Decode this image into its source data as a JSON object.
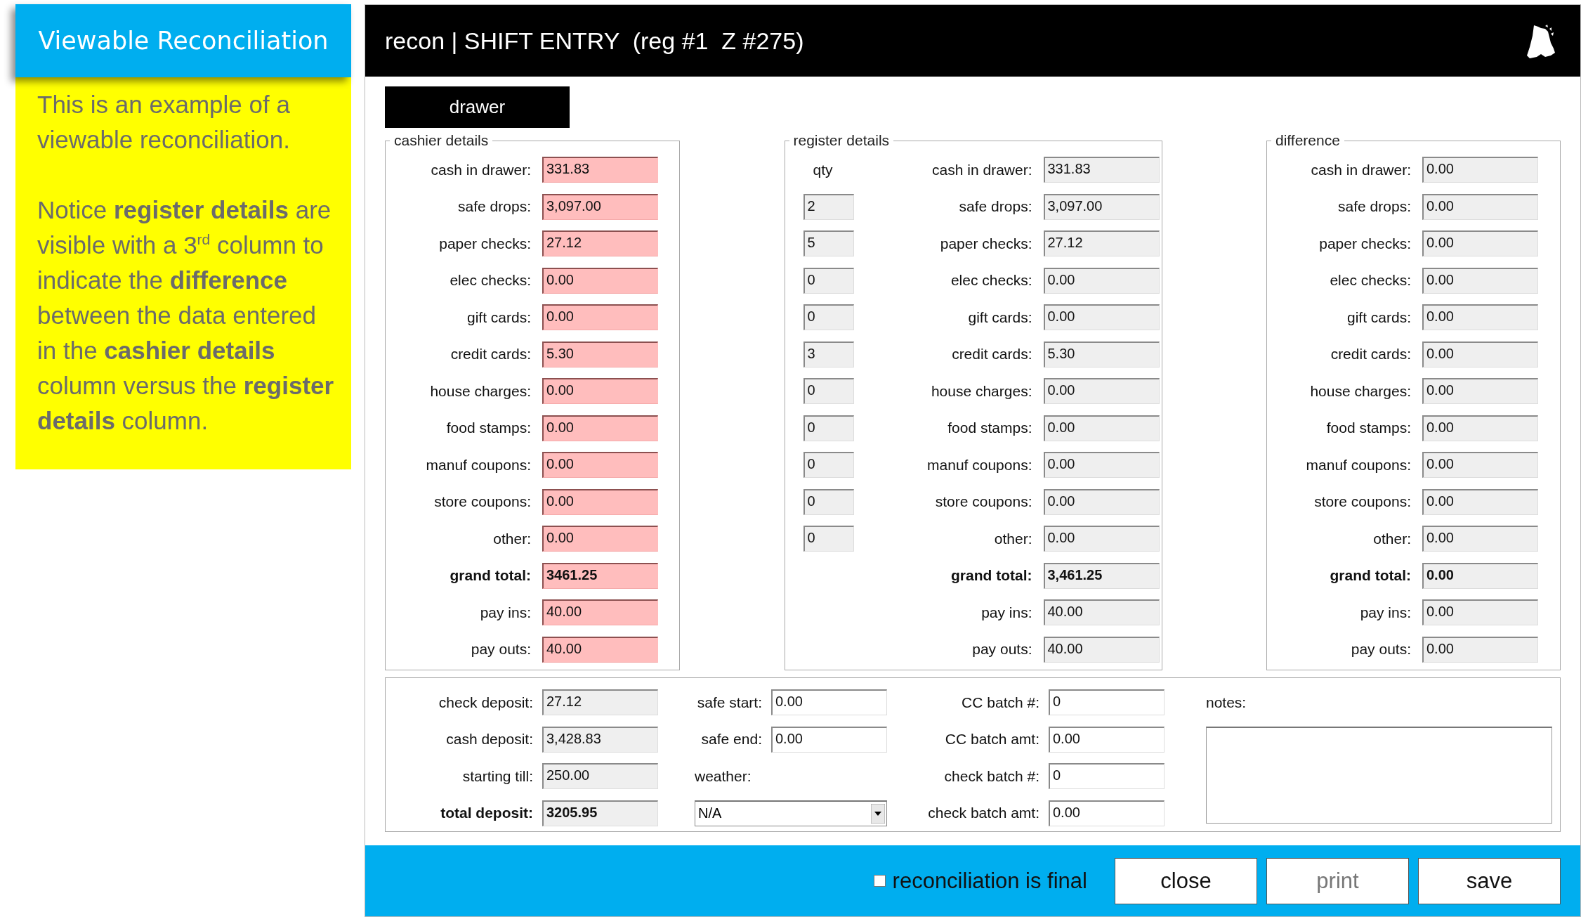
{
  "callout": {
    "title": "Viewable Reconciliation",
    "paragraphs": [
      "This is an example of a viewable reconciliation.",
      "Notice **register details** are visible with a 3$^{rd}$ column to indicate the **difference** between the data entered in the **cashier details** column versus the **register details** column."
    ]
  },
  "window": {
    "title": "recon | SHIFT ENTRY  (reg #1  Z #275)"
  },
  "tabs": [
    {
      "label": "drawer",
      "selected": true
    }
  ],
  "cashier_details": {
    "legend": "cashier details",
    "rows": [
      {
        "label": "cash in drawer:",
        "value": "331.83",
        "kind": "flagged",
        "bold": false
      },
      {
        "label": "safe drops:",
        "value": "3,097.00",
        "kind": "flagged",
        "bold": false
      },
      {
        "label": "paper checks:",
        "value": "27.12",
        "kind": "flagged",
        "bold": false
      },
      {
        "label": "elec checks:",
        "value": "0.00",
        "kind": "flagged",
        "bold": false
      },
      {
        "label": "gift cards:",
        "value": "0.00",
        "kind": "flagged",
        "bold": false
      },
      {
        "label": "credit cards:",
        "value": "5.30",
        "kind": "flagged",
        "bold": false
      },
      {
        "label": "house charges:",
        "value": "0.00",
        "kind": "flagged",
        "bold": false
      },
      {
        "label": "food stamps:",
        "value": "0.00",
        "kind": "flagged",
        "bold": false
      },
      {
        "label": "manuf coupons:",
        "value": "0.00",
        "kind": "flagged",
        "bold": false
      },
      {
        "label": "store coupons:",
        "value": "0.00",
        "kind": "flagged",
        "bold": false
      },
      {
        "label": "other:",
        "value": "0.00",
        "kind": "flagged",
        "bold": false
      },
      {
        "label": "grand total:",
        "value": "3461.25",
        "kind": "flagged",
        "bold": true
      },
      {
        "label": "pay ins:",
        "value": "40.00",
        "kind": "flagged",
        "bold": false
      },
      {
        "label": "pay outs:",
        "value": "40.00",
        "kind": "flagged",
        "bold": false
      }
    ]
  },
  "register_details": {
    "legend": "register details",
    "qty_header": "qty",
    "rows": [
      {
        "qty": "2",
        "label": "safe drops:",
        "value": "3,097.00",
        "kind": "readonly",
        "bold": false
      },
      {
        "qty": "5",
        "label": "paper checks:",
        "value": "27.12",
        "kind": "readonly",
        "bold": false
      },
      {
        "qty": "0",
        "label": "elec checks:",
        "value": "0.00",
        "kind": "readonly",
        "bold": false
      },
      {
        "qty": "0",
        "label": "gift cards:",
        "value": "0.00",
        "kind": "readonly",
        "bold": false
      },
      {
        "qty": "3",
        "label": "credit cards:",
        "value": "5.30",
        "kind": "readonly",
        "bold": false
      },
      {
        "qty": "0",
        "label": "house charges:",
        "value": "0.00",
        "kind": "readonly",
        "bold": false
      },
      {
        "qty": "0",
        "label": "food stamps:",
        "value": "0.00",
        "kind": "readonly",
        "bold": false
      },
      {
        "qty": "0",
        "label": "manuf coupons:",
        "value": "0.00",
        "kind": "readonly",
        "bold": false
      },
      {
        "qty": "0",
        "label": "store coupons:",
        "value": "0.00",
        "kind": "readonly",
        "bold": false
      },
      {
        "qty": "0",
        "label": "other:",
        "value": "0.00",
        "kind": "readonly",
        "bold": false
      },
      {
        "label": "grand total:",
        "value": "3,461.25",
        "kind": "readonly",
        "bold": true
      },
      {
        "label": "pay ins:",
        "value": "40.00",
        "kind": "readonly",
        "bold": false
      },
      {
        "label": "pay outs:",
        "value": "40.00",
        "kind": "readonly",
        "bold": false
      }
    ],
    "first_row": {
      "label": "cash in drawer:",
      "value": "331.83",
      "kind": "readonly",
      "bold": false
    }
  },
  "difference": {
    "legend": "difference",
    "rows": [
      {
        "label": "cash in drawer:",
        "value": "0.00",
        "kind": "readonly",
        "bold": false
      },
      {
        "label": "safe drops:",
        "value": "0.00",
        "kind": "readonly",
        "bold": false
      },
      {
        "label": "paper checks:",
        "value": "0.00",
        "kind": "readonly",
        "bold": false
      },
      {
        "label": "elec checks:",
        "value": "0.00",
        "kind": "readonly",
        "bold": false
      },
      {
        "label": "gift cards:",
        "value": "0.00",
        "kind": "readonly",
        "bold": false
      },
      {
        "label": "credit cards:",
        "value": "0.00",
        "kind": "readonly",
        "bold": false
      },
      {
        "label": "house charges:",
        "value": "0.00",
        "kind": "readonly",
        "bold": false
      },
      {
        "label": "food stamps:",
        "value": "0.00",
        "kind": "readonly",
        "bold": false
      },
      {
        "label": "manuf coupons:",
        "value": "0.00",
        "kind": "readonly",
        "bold": false
      },
      {
        "label": "store coupons:",
        "value": "0.00",
        "kind": "readonly",
        "bold": false
      },
      {
        "label": "other:",
        "value": "0.00",
        "kind": "readonly",
        "bold": false
      },
      {
        "label": "grand total:",
        "value": "0.00",
        "kind": "readonly",
        "bold": true
      },
      {
        "label": "pay ins:",
        "value": "0.00",
        "kind": "readonly",
        "bold": false
      },
      {
        "label": "pay outs:",
        "value": "0.00",
        "kind": "readonly",
        "bold": false
      }
    ]
  },
  "deposit": {
    "columns": [
      [
        {
          "label": "check deposit:",
          "value": "27.12",
          "kind": "readonly",
          "bold": false
        },
        {
          "label": "cash deposit:",
          "value": "3,428.83",
          "kind": "readonly",
          "bold": false
        },
        {
          "label": "starting till:",
          "value": "250.00",
          "kind": "readonly",
          "bold": false
        },
        {
          "label": "total deposit:",
          "value": "3205.95",
          "kind": "readonly",
          "bold": true
        }
      ],
      [
        {
          "label": "safe start:",
          "value": "0.00",
          "kind": "editable",
          "bold": false
        },
        {
          "label": "safe end:",
          "value": "0.00",
          "kind": "editable",
          "bold": false
        }
      ],
      [
        {
          "label": "CC batch #:",
          "value": "0",
          "kind": "editable",
          "bold": false
        },
        {
          "label": "CC batch amt:",
          "value": "0.00",
          "kind": "editable",
          "bold": false
        },
        {
          "label": "check batch #:",
          "value": "0",
          "kind": "editable",
          "bold": false
        },
        {
          "label": "check batch amt:",
          "value": "0.00",
          "kind": "editable",
          "bold": false
        }
      ]
    ],
    "weather": {
      "label": "weather:",
      "value": "N/A"
    },
    "notes": {
      "label": "notes:"
    }
  },
  "footer": {
    "final_checkbox": {
      "label": "reconciliation is final",
      "checked": false
    },
    "buttons": [
      {
        "label": "close",
        "disabled": false
      },
      {
        "label": "print",
        "disabled": true
      },
      {
        "label": "save",
        "disabled": false
      }
    ]
  }
}
